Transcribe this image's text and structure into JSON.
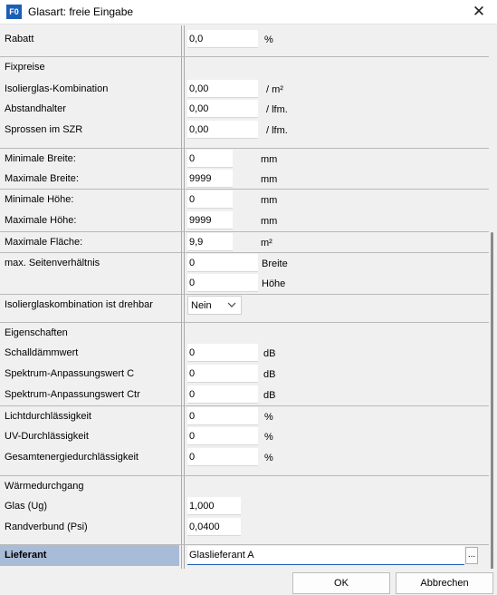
{
  "window": {
    "icon_text": "F0",
    "title": "Glasart: freie Eingabe",
    "close_symbol": "✕"
  },
  "rows": {
    "rabatt": {
      "label": "Rabatt",
      "value": "0,0",
      "unit": "%"
    },
    "fixpreise_heading": "Fixpreise",
    "isolierglas": {
      "label": "Isolierglas-Kombination",
      "value": "0,00",
      "unit": "/ m²"
    },
    "abstandhalter": {
      "label": "Abstandhalter",
      "value": "0,00",
      "unit": "/ lfm."
    },
    "sprossen": {
      "label": "Sprossen im SZR",
      "value": "0,00",
      "unit": "/ lfm."
    },
    "min_breite": {
      "label": "Minimale Breite:",
      "value": "0",
      "unit": "mm"
    },
    "max_breite": {
      "label": "Maximale Breite:",
      "value": "9999",
      "unit": "mm"
    },
    "min_hoehe": {
      "label": "Minimale Höhe:",
      "value": "0",
      "unit": "mm"
    },
    "max_hoehe": {
      "label": "Maximale Höhe:",
      "value": "9999",
      "unit": "mm"
    },
    "max_flaeche": {
      "label": "Maximale Fläche:",
      "value": "9,9",
      "unit": "m²"
    },
    "seitenverhaeltnis": {
      "label": "max. Seitenverhältnis",
      "value_breite": "0",
      "unit_breite": "Breite",
      "value_hoehe": "0",
      "unit_hoehe": "Höhe"
    },
    "drehbar": {
      "label": "Isolierglaskombination ist drehbar",
      "value": "Nein"
    },
    "eigenschaften_heading": "Eigenschaften",
    "schalldaemm": {
      "label": "Schalldämmwert",
      "value": "0",
      "unit": "dB"
    },
    "spektrum_c": {
      "label": "Spektrum-Anpassungswert C",
      "value": "0",
      "unit": "dB"
    },
    "spektrum_ctr": {
      "label": "Spektrum-Anpassungswert Ctr",
      "value": "0",
      "unit": "dB"
    },
    "licht": {
      "label": "Lichtdurchlässigkeit",
      "value": "0",
      "unit": "%"
    },
    "uv": {
      "label": "UV-Durchlässigkeit",
      "value": "0",
      "unit": "%"
    },
    "gesamtenergie": {
      "label": "Gesamtenergiedurchlässigkeit",
      "value": "0",
      "unit": "%"
    },
    "waerme_heading": "Wärmedurchgang",
    "glas_ug": {
      "label": "Glas (Ug)",
      "value": "1,000"
    },
    "randverbund": {
      "label": "Randverbund (Psi)",
      "value": "0,0400"
    },
    "lieferant": {
      "label": "Lieferant",
      "value": "Glaslieferant A",
      "button": "..."
    }
  },
  "buttons": {
    "ok": "OK",
    "cancel": "Abbrechen"
  },
  "colors": {
    "selected_label_bg": "#a9bcd7",
    "focus_accent": "#1a5fb4"
  }
}
